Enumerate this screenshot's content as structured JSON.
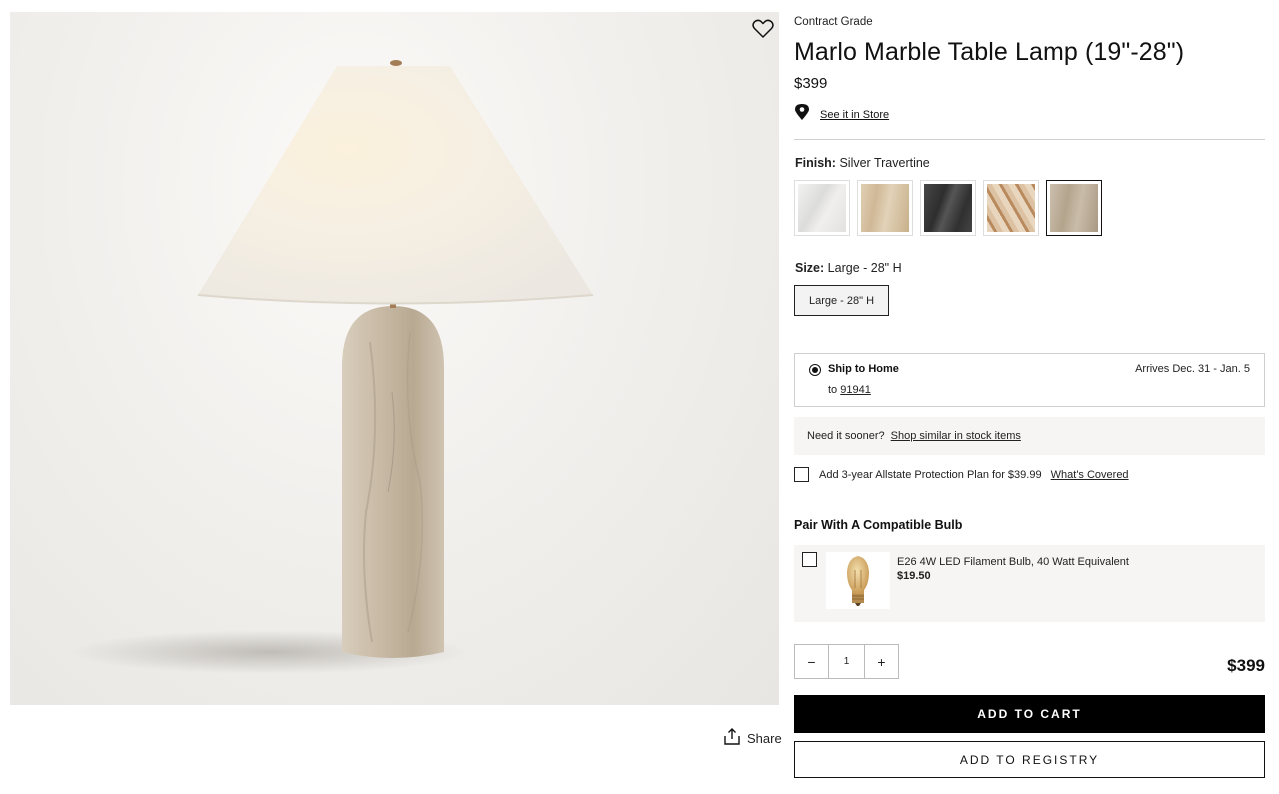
{
  "product": {
    "grade": "Contract Grade",
    "title": "Marlo Marble Table Lamp (19\"-28\")",
    "price": "$399",
    "store_link": "See it in Store",
    "share_label": "Share"
  },
  "finish": {
    "label": "Finish:",
    "selected": "Silver Travertine",
    "swatches": [
      {
        "name": "white-marble",
        "color": "#e9e8e6"
      },
      {
        "name": "beige-travertine",
        "color": "#d9c5a8"
      },
      {
        "name": "black-marble",
        "color": "#3b3b3b"
      },
      {
        "name": "swirl-stone",
        "color": "#c8a07a"
      },
      {
        "name": "silver-travertine",
        "color": "#bfb09a"
      }
    ],
    "selected_index": 4
  },
  "size": {
    "label": "Size:",
    "selected": "Large - 28\" H",
    "options": [
      "Large - 28\" H"
    ]
  },
  "shipping": {
    "method": "Ship to Home",
    "to_prefix": "to",
    "zip": "91941",
    "arrival": "Arrives Dec. 31 - Jan. 5"
  },
  "sooner": {
    "text": "Need it sooner?",
    "link": "Shop similar in stock items"
  },
  "protection": {
    "text": "Add 3-year Allstate Protection Plan for $39.99",
    "link": "What's Covered"
  },
  "bulb": {
    "section_title": "Pair With A Compatible Bulb",
    "name": "E26 4W LED Filament Bulb, 40 Watt Equivalent",
    "price": "$19.50"
  },
  "cart": {
    "qty": "1",
    "minus": "−",
    "plus": "+",
    "total": "$399",
    "add_to_cart": "ADD TO CART",
    "add_to_registry": "ADD TO REGISTRY"
  },
  "colors": {
    "accent": "#000000",
    "panel_bg": "#f6f5f3",
    "divider": "#cfcfcf"
  }
}
